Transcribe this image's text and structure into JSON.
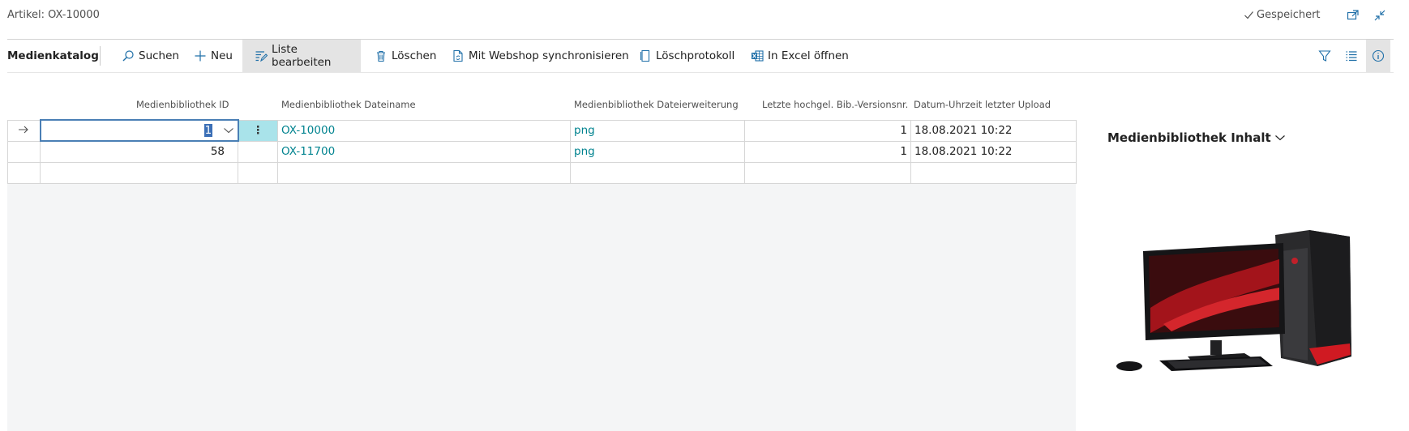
{
  "window": {
    "title": "Artikel: OX-10000",
    "status": "Gespeichert"
  },
  "toolbar": {
    "page_name": "Medienkatalog",
    "actions": [
      {
        "label": "Suchen",
        "icon": "search-icon"
      },
      {
        "label": "Neu",
        "icon": "plus-icon"
      },
      {
        "label": "Liste bearbeiten",
        "icon": "edit-list-icon",
        "active": true
      },
      {
        "label": "Löschen",
        "icon": "trash-icon"
      },
      {
        "label": "Mit Webshop synchronisieren",
        "icon": "sync-document-icon"
      },
      {
        "label": "Löschprotokoll",
        "icon": "log-icon"
      },
      {
        "label": "In Excel öffnen",
        "icon": "excel-icon"
      }
    ],
    "right_icons": [
      "filter-icon",
      "list-view-icon",
      "info-icon"
    ]
  },
  "table": {
    "columns": [
      "Medienbibliothek ID",
      "Medienbibliothek Dateiname",
      "Medienbibliothek Dateierweiterung",
      "Letzte hochgel. Bib.-Versionsnr.",
      "Datum-Uhrzeit letzter Upload"
    ],
    "rows": [
      {
        "id": "1",
        "filename": "OX-10000",
        "ext": "png",
        "version": "1",
        "uploaded": "18.08.2021 10:22"
      },
      {
        "id": "58",
        "filename": "OX-11700",
        "ext": "png",
        "version": "1",
        "uploaded": "18.08.2021 10:22"
      }
    ]
  },
  "factbox": {
    "title": "Medienbibliothek Inhalt",
    "image_alt": "desktop-pc-image"
  },
  "colors": {
    "link": "#00838f",
    "selected_row_action": "#a9e3ea",
    "active_action_bg": "#e4e4e4"
  }
}
